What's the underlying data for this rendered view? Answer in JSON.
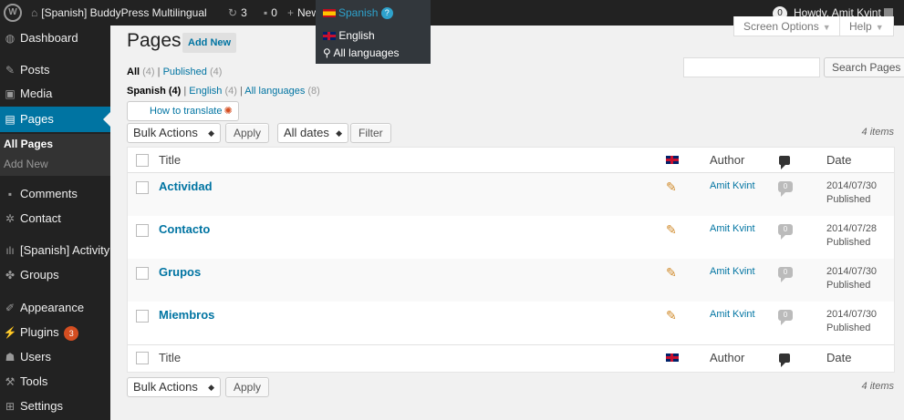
{
  "admin_bar": {
    "site_name": "[Spanish] BuddyPress Multilingual",
    "updates_count": "3",
    "comments_count": "0",
    "new_label": "New",
    "language_current": "Spanish",
    "language_options": [
      "English",
      "All languages"
    ],
    "notifications_count": "0",
    "howdy": "Howdy, Amit Kvint"
  },
  "sidebar": {
    "items": [
      {
        "label": "Dashboard",
        "icon": "dashboard-icon"
      },
      {
        "label": "Posts",
        "icon": "pin-icon"
      },
      {
        "label": "Media",
        "icon": "media-icon"
      },
      {
        "label": "Pages",
        "icon": "page-icon"
      },
      {
        "label": "Comments",
        "icon": "comment-icon"
      },
      {
        "label": "Contact",
        "icon": "contact-icon"
      },
      {
        "label": "[Spanish] Activity",
        "icon": "activity-icon"
      },
      {
        "label": "Groups",
        "icon": "groups-icon"
      },
      {
        "label": "Appearance",
        "icon": "appearance-icon"
      },
      {
        "label": "Plugins",
        "icon": "plugins-icon",
        "badge": "3"
      },
      {
        "label": "Users",
        "icon": "users-icon"
      },
      {
        "label": "Tools",
        "icon": "tools-icon"
      },
      {
        "label": "Settings",
        "icon": "settings-icon"
      }
    ],
    "submenu": [
      "All Pages",
      "Add New"
    ]
  },
  "header": {
    "title": "Pages",
    "add_new": "Add New",
    "screen_options": "Screen Options",
    "help": "Help"
  },
  "filters": {
    "status": [
      {
        "label": "All",
        "count": "(4)"
      },
      {
        "label": "Published",
        "count": "(4)"
      }
    ],
    "languages": [
      {
        "label": "Spanish",
        "count": "(4)"
      },
      {
        "label": "English",
        "count": "(4)"
      },
      {
        "label": "All languages",
        "count": "(8)"
      }
    ],
    "how_to_translate": "How to translate",
    "bulk_actions": "Bulk Actions",
    "apply": "Apply",
    "all_dates": "All dates",
    "filter": "Filter",
    "search_button": "Search Pages",
    "items_count": "4 items"
  },
  "table": {
    "columns": {
      "title": "Title",
      "author": "Author",
      "date": "Date"
    },
    "rows": [
      {
        "title": "Actividad",
        "author": "Amit Kvint",
        "comments": "0",
        "date": "2014/07/30",
        "status": "Published"
      },
      {
        "title": "Contacto",
        "author": "Amit Kvint",
        "comments": "0",
        "date": "2014/07/28",
        "status": "Published"
      },
      {
        "title": "Grupos",
        "author": "Amit Kvint",
        "comments": "0",
        "date": "2014/07/30",
        "status": "Published"
      },
      {
        "title": "Miembros",
        "author": "Amit Kvint",
        "comments": "0",
        "date": "2014/07/30",
        "status": "Published"
      }
    ]
  },
  "colors": {
    "admin_bar": "#222222",
    "sidebar_active": "#0074a2",
    "link": "#0074a2",
    "badge": "#d54e21"
  }
}
